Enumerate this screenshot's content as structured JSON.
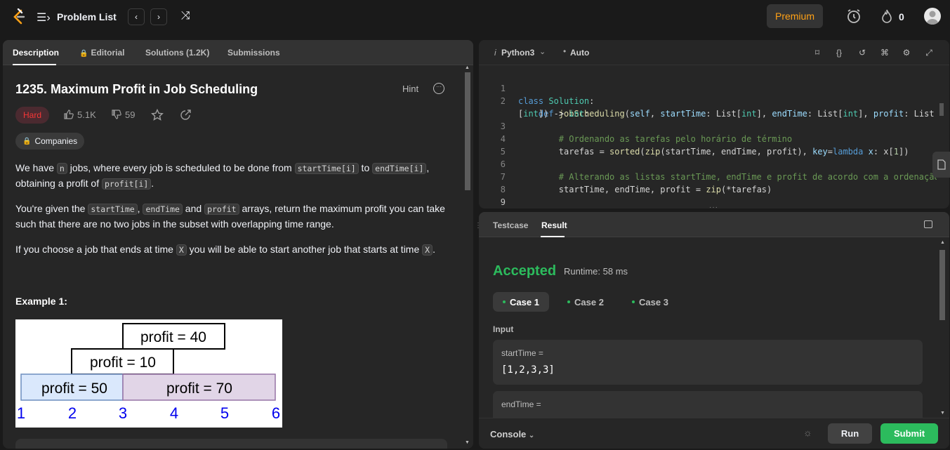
{
  "header": {
    "title": "Problem List",
    "premium_label": "Premium",
    "streak_count": "0"
  },
  "left_tabs": {
    "description": "Description",
    "editorial": "Editorial",
    "solutions": "Solutions (1.2K)",
    "submissions": "Submissions"
  },
  "problem": {
    "title": "1235. Maximum Profit in Job Scheduling",
    "hint_label": "Hint",
    "difficulty": "Hard",
    "likes": "5.1K",
    "dislikes": "59",
    "companies_label": "Companies",
    "p1_a": "We have ",
    "p1_code_n": "n",
    "p1_b": " jobs, where every job is scheduled to be done from ",
    "p1_code_start": "startTime[i]",
    "p1_c": " to ",
    "p1_code_end": "endTime[i]",
    "p1_d": ",",
    "p1_e": "obtaining a profit of ",
    "p1_code_profit": "profit[i]",
    "p1_f": ".",
    "p2_a": "You're given the ",
    "p2_code1": "startTime",
    "p2_b": ", ",
    "p2_code2": "endTime",
    "p2_c": " and ",
    "p2_code3": "profit",
    "p2_d": " arrays, return the maximum profit you can take",
    "p2_e": "such that there are no two jobs in the subset with overlapping time range.",
    "p3_a": "If you choose a job that ends at time ",
    "p3_code1": "X",
    "p3_b": " you will be able to start another job that starts at time ",
    "p3_code2": "X",
    "p3_c": ".",
    "example_title": "Example 1:",
    "example_image": {
      "boxes": [
        "profit = 40",
        "profit = 10",
        "profit = 50",
        "profit = 70"
      ],
      "axis": [
        "1",
        "2",
        "3",
        "4",
        "5",
        "6"
      ]
    }
  },
  "editor": {
    "language": "Python3",
    "mode": "Auto",
    "line_numbers": [
      "1",
      "2",
      "",
      "3",
      "4",
      "5",
      "6",
      "7",
      "8",
      "9",
      "10"
    ]
  },
  "result_tabs": {
    "testcase": "Testcase",
    "result": "Result"
  },
  "result": {
    "status": "Accepted",
    "runtime": "Runtime: 58 ms",
    "cases": [
      "Case 1",
      "Case 2",
      "Case 3"
    ],
    "input_label": "Input",
    "var1_name": "startTime =",
    "var1_value": "[1,2,3,3]",
    "var2_name": "endTime ="
  },
  "footer": {
    "console_label": "Console",
    "run_label": "Run",
    "submit_label": "Submit"
  },
  "colors": {
    "accent": "#ffa116",
    "accepted": "#2cbb5d",
    "hard": "#f63636"
  }
}
